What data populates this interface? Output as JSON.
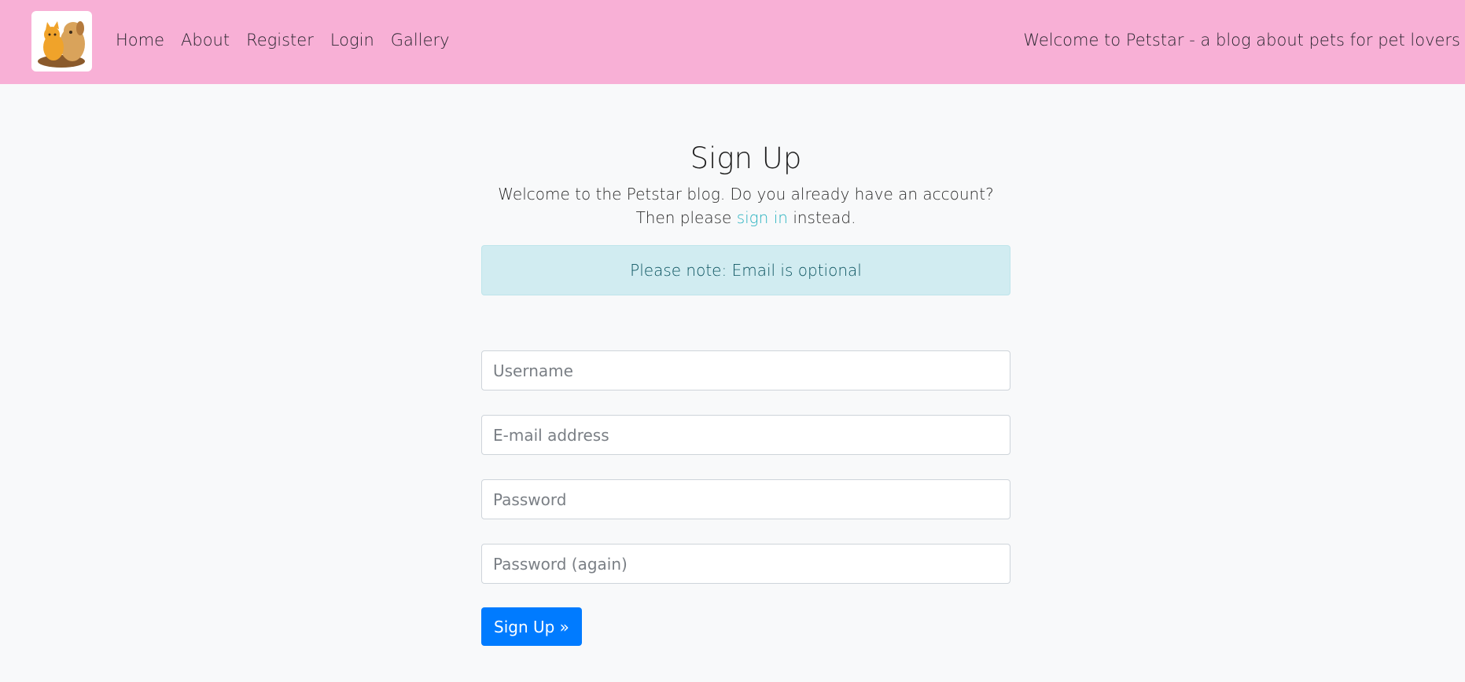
{
  "nav": {
    "logo_alt": "Petstar logo",
    "links": [
      "Home",
      "About",
      "Register",
      "Login",
      "Gallery"
    ],
    "tagline": "Welcome to Petstar - a blog about pets for pet lovers"
  },
  "main": {
    "title": "Sign Up",
    "intro_line1": "Welcome to the Petstar blog. Do you already have an account?",
    "intro_prefix": "Then please",
    "intro_link": "sign in",
    "intro_suffix": "instead.",
    "alert": "Please note: Email is optional"
  },
  "form": {
    "username_placeholder": "Username",
    "email_placeholder": "E-mail address",
    "password_placeholder": "Password",
    "password2_placeholder": "Password (again)",
    "submit_label": "Sign Up »"
  },
  "colors": {
    "navbar": "#f8b0d6",
    "link": "#2bb3c0",
    "alert_bg": "#d1ecf1",
    "button": "#007bff"
  }
}
